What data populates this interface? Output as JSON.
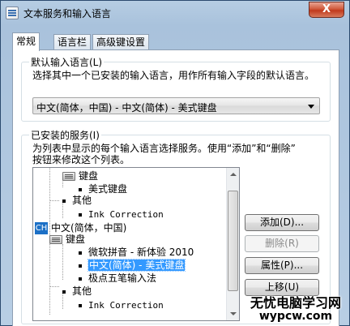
{
  "window": {
    "title": "文本服务和输入语言",
    "close_label": "X"
  },
  "tabs": [
    {
      "label": "常规",
      "active": true
    },
    {
      "label": "语言栏",
      "active": false
    },
    {
      "label": "高级键设置",
      "active": false
    }
  ],
  "default_language": {
    "group_label": "默认输入语言(L)",
    "description": "选择其中一个已安装的输入语言，用作所有输入字段的默认语言。",
    "selected": "中文(简体，中国) - 中文(简体) - 美式键盘"
  },
  "installed_services": {
    "group_label": "已安装的服务(I)",
    "description_line1": "为列表中显示的每个输入语言选择服务。使用“添加”和“删除”",
    "description_line2": "按钮来修改这个列表。",
    "tree": {
      "n1": "键盘",
      "n2": "美式键盘",
      "n3": "其他",
      "n4": "Ink Correction",
      "n5_icon": "CH",
      "n5": "中文(简体，中国)",
      "n6": "键盘",
      "n7": "微软拼音 - 新体验 2010",
      "n8": "中文(简体) - 美式键盘",
      "n9": "极点五笔输入法",
      "n10": "其他",
      "n11": "Ink Correction"
    },
    "buttons": {
      "add": "添加(D)...",
      "remove": "删除(R)",
      "properties": "属性(P)...",
      "move_up": "上移(U)"
    }
  },
  "watermark": {
    "line1": "无忧电脑学习网",
    "line2": "wypcw.com"
  }
}
